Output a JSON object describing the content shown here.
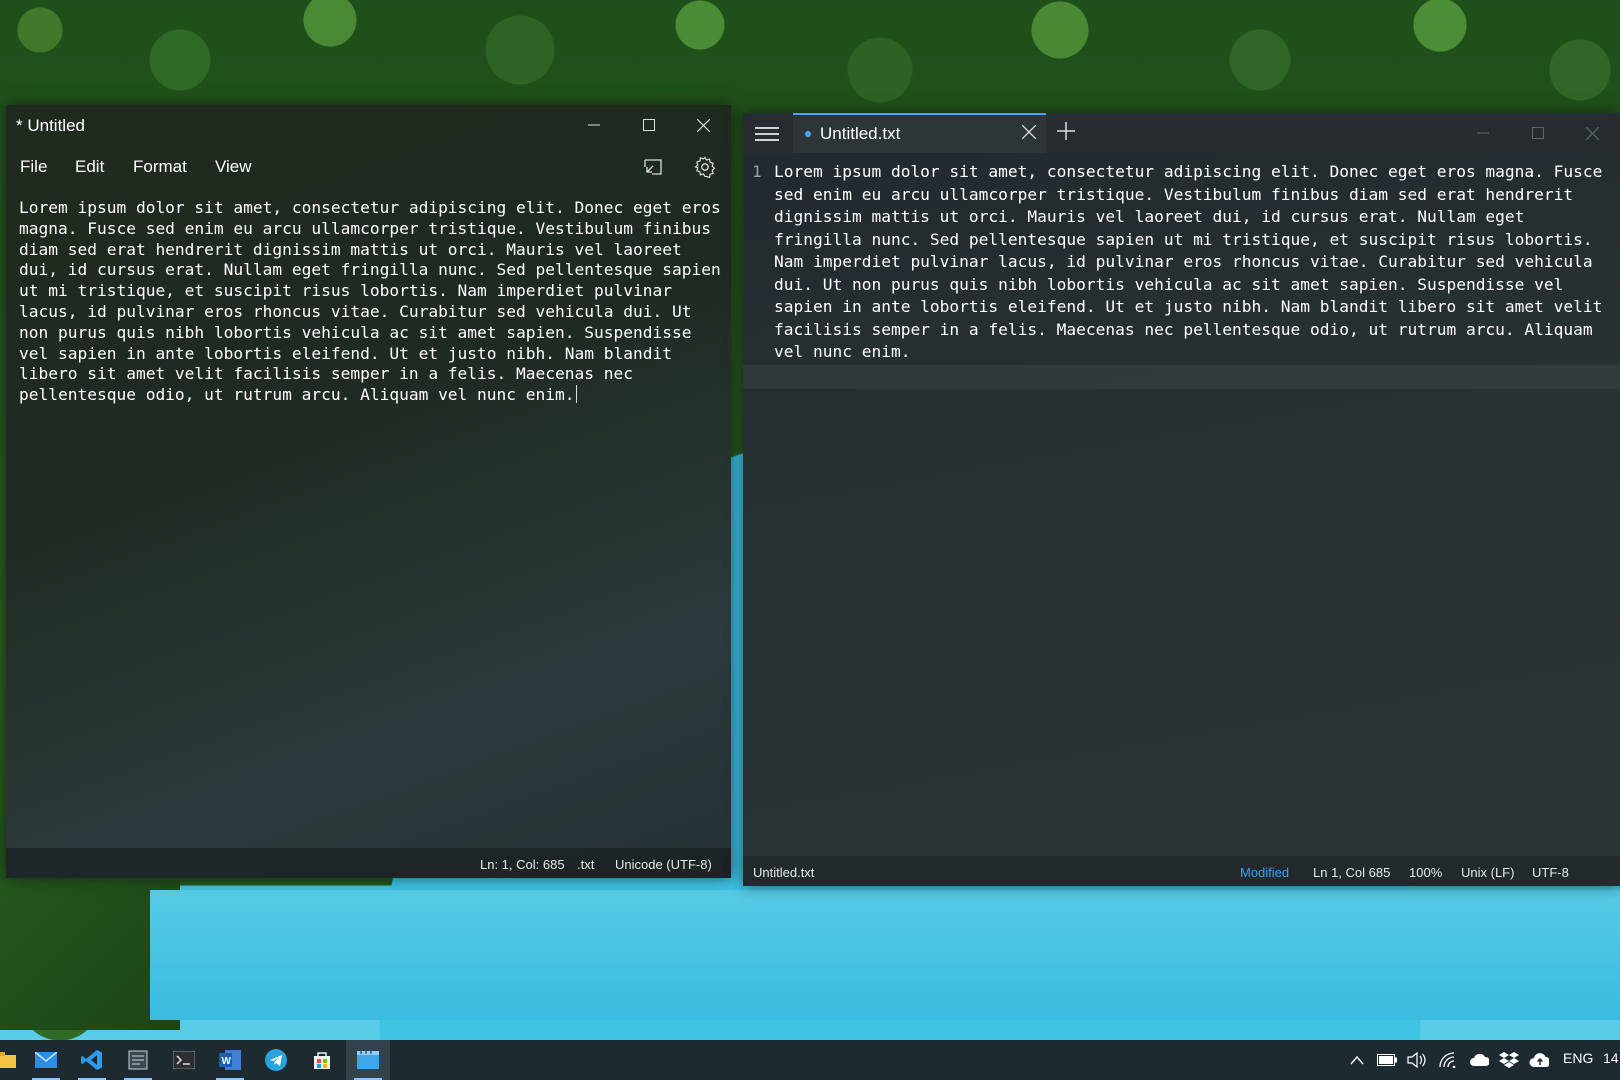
{
  "notepad": {
    "title": "* Untitled",
    "menu": [
      "File",
      "Edit",
      "Format",
      "View"
    ],
    "content": "Lorem ipsum dolor sit amet, consectetur adipiscing elit. Donec eget eros magna. Fusce sed enim eu arcu ullamcorper tristique. Vestibulum finibus diam sed erat hendrerit dignissim mattis ut orci. Mauris vel laoreet dui, id cursus erat. Nullam eget fringilla nunc. Sed pellentesque sapien ut mi tristique, et suscipit risus lobortis. Nam imperdiet pulvinar lacus, id pulvinar eros rhoncus vitae. Curabitur sed vehicula dui. Ut non purus quis nibh lobortis vehicula ac sit amet sapien. Suspendisse vel sapien in ante lobortis eleifend. Ut et justo nibh. Nam blandit libero sit amet velit facilisis semper in a felis. Maecenas nec pellentesque odio, ut rutrum arcu. Aliquam vel nunc enim.",
    "status": {
      "position": "Ln: 1, Col: 685",
      "extension": ".txt",
      "encoding": "Unicode (UTF-8)"
    },
    "icons": [
      "compact-overlay-icon",
      "gear-icon"
    ]
  },
  "notepads": {
    "tab_label": "Untitled.txt",
    "line_number": "1",
    "content": "Lorem ipsum dolor sit amet, consectetur adipiscing elit. Donec eget eros magna. Fusce sed enim eu arcu ullamcorper tristique. Vestibulum finibus diam sed erat hendrerit dignissim mattis ut orci. Mauris vel laoreet dui, id cursus erat. Nullam eget fringilla nunc. Sed pellentesque sapien ut mi tristique, et suscipit risus lobortis. Nam imperdiet pulvinar lacus, id pulvinar eros rhoncus vitae. Curabitur sed vehicula dui. Ut non purus quis nibh lobortis vehicula ac sit amet sapien. Suspendisse vel sapien in ante lobortis eleifend. Ut et justo nibh. Nam blandit libero sit amet velit facilisis semper in a felis. Maecenas nec pellentesque odio, ut rutrum arcu. Aliquam vel nunc enim.",
    "status": {
      "filename": "Untitled.txt",
      "modified": "Modified",
      "position": "Ln 1, Col 685",
      "zoom": "100%",
      "line_ending": "Unix (LF)",
      "encoding": "UTF-8"
    },
    "accent_color": "#3b9cff"
  },
  "taskbar": {
    "apps": [
      "file-explorer-icon",
      "mail-icon",
      "vscode-icon",
      "notepad-icon",
      "terminal-icon",
      "word-icon",
      "telegram-icon",
      "store-icon",
      "notepads-icon"
    ],
    "tray": {
      "language": "ENG",
      "clock": "14"
    }
  }
}
